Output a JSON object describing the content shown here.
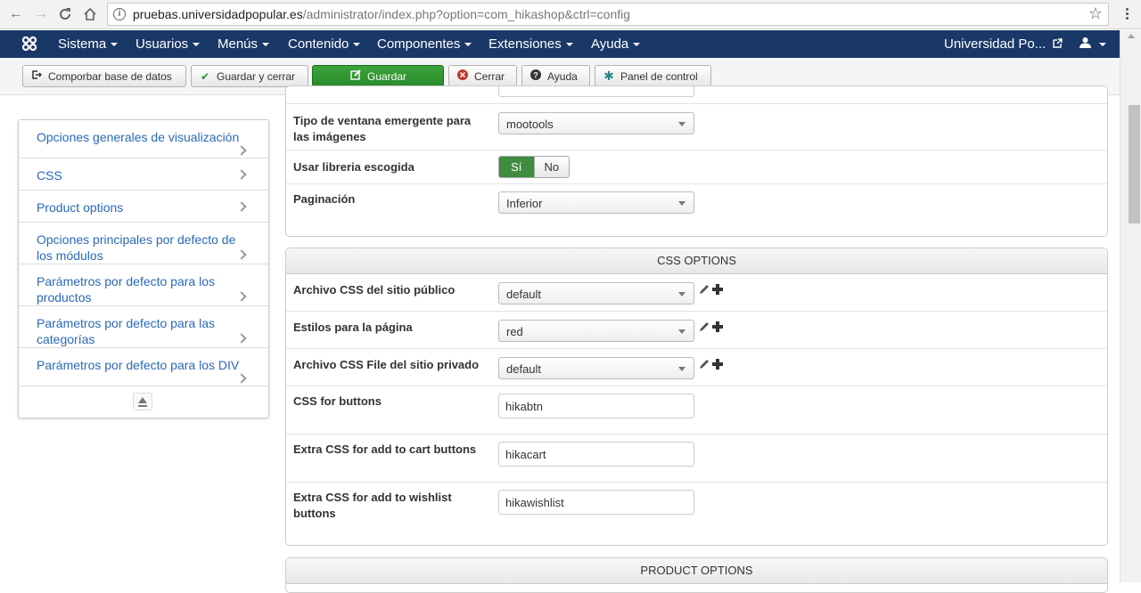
{
  "browser": {
    "url_host": "pruebas.universidadpopular.es",
    "url_path": "/administrator/index.php?option=com_hikashop&ctrl=config"
  },
  "navbar": {
    "items": [
      "Sistema",
      "Usuarios",
      "Menús",
      "Contenido",
      "Componentes",
      "Extensiones",
      "Ayuda"
    ],
    "site_link": "Universidad Po..."
  },
  "toolbar": {
    "check_db": "Comporbar base de datos",
    "save_close": "Guardar y cerrar",
    "save": "Guardar",
    "close": "Cerrar",
    "help": "Ayuda",
    "control_panel": "Panel de control"
  },
  "sidemenu": {
    "items": [
      "Opciones generales de visualización",
      "CSS",
      "Product options",
      "Opciones principales por defecto de los módulos",
      "Parámetros por defecto para los productos",
      "Parámetros por defecto para las categorías",
      "Parámetros por defecto para los DIV"
    ]
  },
  "display_panel": {
    "rows": [
      {
        "label": "Tipo de ventana emergente para las imágenes",
        "value": "mootools"
      },
      {
        "label": "Usar libreria escogida",
        "yes": "Sí",
        "no": "No"
      },
      {
        "label": "Paginación",
        "value": "Inferior"
      }
    ]
  },
  "css_panel": {
    "title": "CSS OPTIONS",
    "rows": [
      {
        "label": "Archivo CSS del sitio público",
        "value": "default"
      },
      {
        "label": "Estilos para la página",
        "value": "red"
      },
      {
        "label": "Archivo CSS File del sitio privado",
        "value": "default"
      },
      {
        "label": "CSS for buttons",
        "value": "hikabtn"
      },
      {
        "label": "Extra CSS for add to cart buttons",
        "value": "hikacart"
      },
      {
        "label": "Extra CSS for add to wishlist buttons",
        "value": "hikawishlist"
      }
    ]
  },
  "product_panel": {
    "title": "PRODUCT OPTIONS"
  },
  "colors": {
    "navbar": "#1a3867",
    "success": "#2f8f2f",
    "link": "#2a69b8"
  }
}
